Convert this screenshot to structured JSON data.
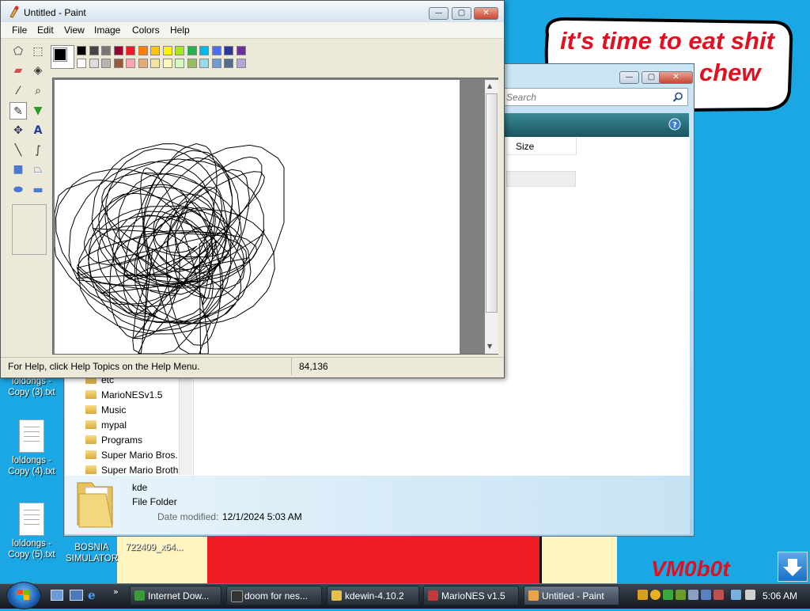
{
  "desktop": {
    "bubble_line1": "it's time to eat shit",
    "bubble_line2": "chew",
    "signature": "VM0b0t",
    "icons": [
      {
        "label_line1": "loldongs -",
        "label_line2": "Copy (3).txt"
      },
      {
        "label_line1": "loldongs -",
        "label_line2": "Copy (4).txt"
      },
      {
        "label_line1": "loldongs -",
        "label_line2": "Copy (5).txt"
      },
      {
        "label_line1": "BOSNIA",
        "label_line2": "SIMULATOR"
      },
      {
        "label_line1": "722409_x64...",
        "label_line2": ""
      }
    ]
  },
  "explorer": {
    "search_placeholder": "Search",
    "column_size": "Size",
    "nav_items": [
      "etc",
      "MarioNESv1.5",
      "Music",
      "mypal",
      "Programs",
      "Super Mario Bros.",
      "Super Mario Broth"
    ],
    "details": {
      "name": "kde",
      "type": "File Folder",
      "modified_label": "Date modified:",
      "modified_value": "12/1/2024 5:03 AM"
    }
  },
  "paint": {
    "title": "Untitled - Paint",
    "menu": [
      "File",
      "Edit",
      "View",
      "Image",
      "Colors",
      "Help"
    ],
    "status_help": "For Help, click Help Topics on the Help Menu.",
    "status_coords": "84,136",
    "palette_top": [
      "#000000",
      "#464646",
      "#787878",
      "#990030",
      "#ed1c24",
      "#ff7e00",
      "#ffc20e",
      "#fff200",
      "#a8e61d",
      "#22b14c",
      "#00b7ef",
      "#4d6df3",
      "#2f3699",
      "#6f3198"
    ],
    "palette_bottom": [
      "#ffffff",
      "#dcdcdc",
      "#b4b4b4",
      "#9c5a3c",
      "#ffa3b1",
      "#e5aa7a",
      "#f5e49c",
      "#fff9bd",
      "#d3f9bc",
      "#9dbb61",
      "#99d9ea",
      "#709ad1",
      "#546d8e",
      "#b5a5d5"
    ],
    "foreground": "#000000",
    "background": "#ffffff"
  },
  "taskbar": {
    "buttons": [
      "Internet Dow...",
      "doom for nes...",
      "kdewin-4.10.2",
      "MarioNES v1.5",
      "Untitled - Paint"
    ],
    "clock": "5:06 AM"
  }
}
